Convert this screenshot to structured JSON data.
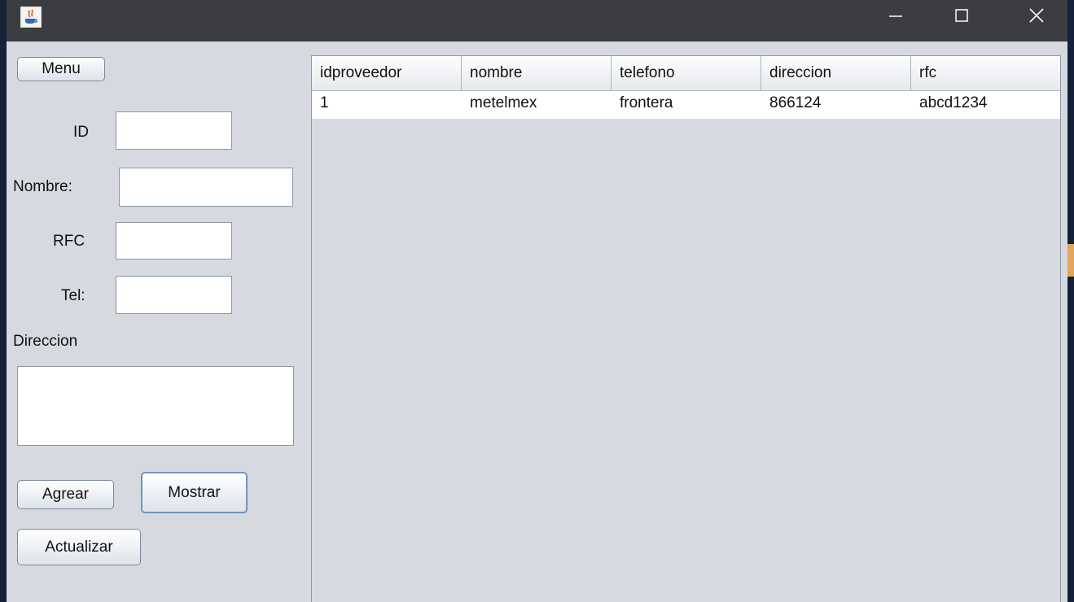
{
  "window": {
    "controls": {
      "minimize_icon": "minimize-icon",
      "maximize_icon": "maximize-icon",
      "close_icon": "close-icon"
    }
  },
  "form": {
    "menu_button": "Menu",
    "id_label": "ID",
    "id_value": "",
    "nombre_label": "Nombre:",
    "nombre_value": "",
    "rfc_label": "RFC",
    "rfc_value": "",
    "tel_label": "Tel:",
    "tel_value": "",
    "direccion_label": "Direccion",
    "direccion_value": "",
    "agregar_button": "Agrear",
    "mostrar_button": "Mostrar",
    "actualizar_button": "Actualizar"
  },
  "table": {
    "columns": [
      "idproveedor",
      "nombre",
      "telefono",
      "direccion",
      "rfc"
    ],
    "rows": [
      [
        "1",
        "metelmex",
        "frontera",
        "866124",
        "abcd1234"
      ]
    ]
  },
  "colors": {
    "titlebar": "#3c3d41",
    "panel": "#d6d9df",
    "desktop": "#16213a",
    "accent": "#e0a55e"
  }
}
